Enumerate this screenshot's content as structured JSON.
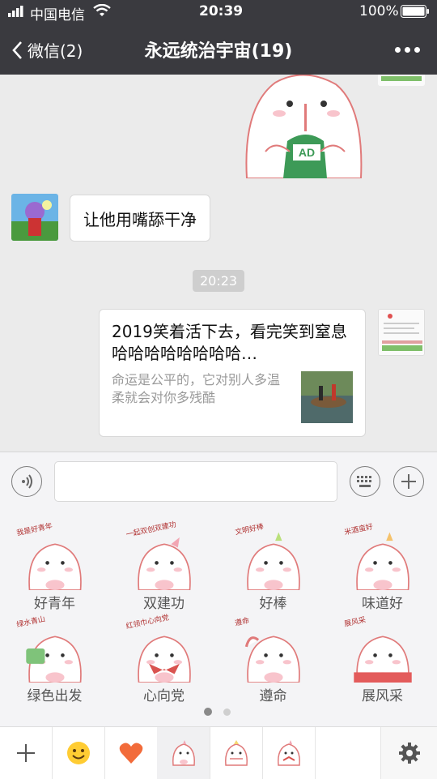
{
  "status_bar": {
    "carrier": "中国电信",
    "time": "20:39",
    "battery_text": "100%"
  },
  "nav": {
    "back_label": "微信(2)",
    "title": "永远统治宇宙(19)"
  },
  "chat": {
    "messages": [
      {
        "type": "text",
        "text": "让他用嘴舔干净"
      },
      {
        "type": "time",
        "text": "20:23"
      },
      {
        "type": "link",
        "title": "2019笑着活下去，看完笑到窒息哈哈哈哈哈哈哈哈…",
        "description": "命运是公平的，它对别人多温柔就会对你多残酷"
      }
    ],
    "sticker_label": "AD"
  },
  "stickers": [
    {
      "label": "好青年",
      "caption": "我是好青年"
    },
    {
      "label": "双建功",
      "caption": "一起双创双建功"
    },
    {
      "label": "好棒",
      "caption": "文明好棒"
    },
    {
      "label": "味道好",
      "caption": "米酒蛮好"
    },
    {
      "label": "绿色出发",
      "caption": "绿水青山"
    },
    {
      "label": "心向党",
      "caption": "红领巾心向党"
    },
    {
      "label": "遵命",
      "caption": "遵命"
    },
    {
      "label": "展风采",
      "caption": "展风采"
    }
  ],
  "pager": {
    "pages": 2,
    "active": 0
  },
  "colors": {
    "topbar": "#3a3a3f",
    "chat_bg": "#ebebeb",
    "panel_bg": "#f4f4f6",
    "sticker_pink": "#f8c4cc",
    "sticker_red": "#d9534f"
  },
  "icons": {
    "voice": "voice-icon",
    "keyboard": "keyboard-icon",
    "add": "plus-icon",
    "emoji": "emoji-icon",
    "favorite": "heart-icon",
    "settings": "gear-icon"
  }
}
